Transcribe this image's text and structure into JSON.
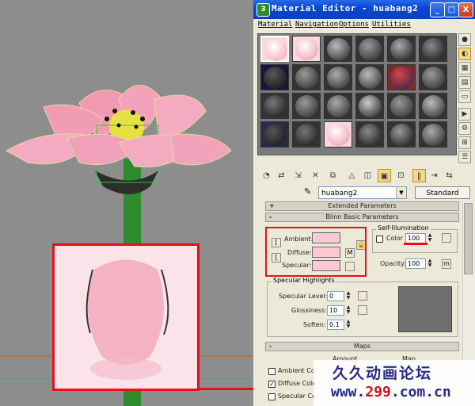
{
  "window": {
    "title": "Material Editor - huabang2",
    "icon": "3ds-max-icon",
    "buttons": {
      "minimize": "_",
      "maximize": "□",
      "close": "X"
    }
  },
  "menu": [
    "Material",
    "Navigation",
    "Options",
    "Utilities"
  ],
  "toolbar": {
    "material_name": "huabang2",
    "material_type": "Standard"
  },
  "rollouts": {
    "extended": "Extended Parameters",
    "blinn": "Blinn Basic Parameters",
    "maps": "Maps"
  },
  "blinn": {
    "ambient_label": "Ambient:",
    "diffuse_label": "Diffuse:",
    "specular_label": "Specular:",
    "map_button": "M",
    "swatch_color": "#ffc8d4",
    "self_illum_title": "Self-Illumination",
    "color_label": "Color",
    "color_value": "100",
    "opacity_label": "Opacity:",
    "opacity_value": "100",
    "opacity_map": "m"
  },
  "specular_highlights": {
    "title": "Specular Highlights",
    "level_label": "Specular Level:",
    "level_value": "0",
    "gloss_label": "Glossiness:",
    "gloss_value": "10",
    "soften_label": "Soften:",
    "soften_value": "0.1"
  },
  "maps": {
    "amount_header": "Amount",
    "map_header": "Map",
    "rows": [
      "Ambient Col",
      "Diffuse Colo",
      "Specular Co"
    ]
  },
  "watermark": {
    "line1": "久久动画论坛",
    "line2_prefix": "www.",
    "line2_red": "299",
    "line2_suffix": ".com.cn"
  },
  "colors": {
    "accent_red": "#e4101a",
    "title_blue": "#0a46d6",
    "pink": "#ffc8d4"
  }
}
